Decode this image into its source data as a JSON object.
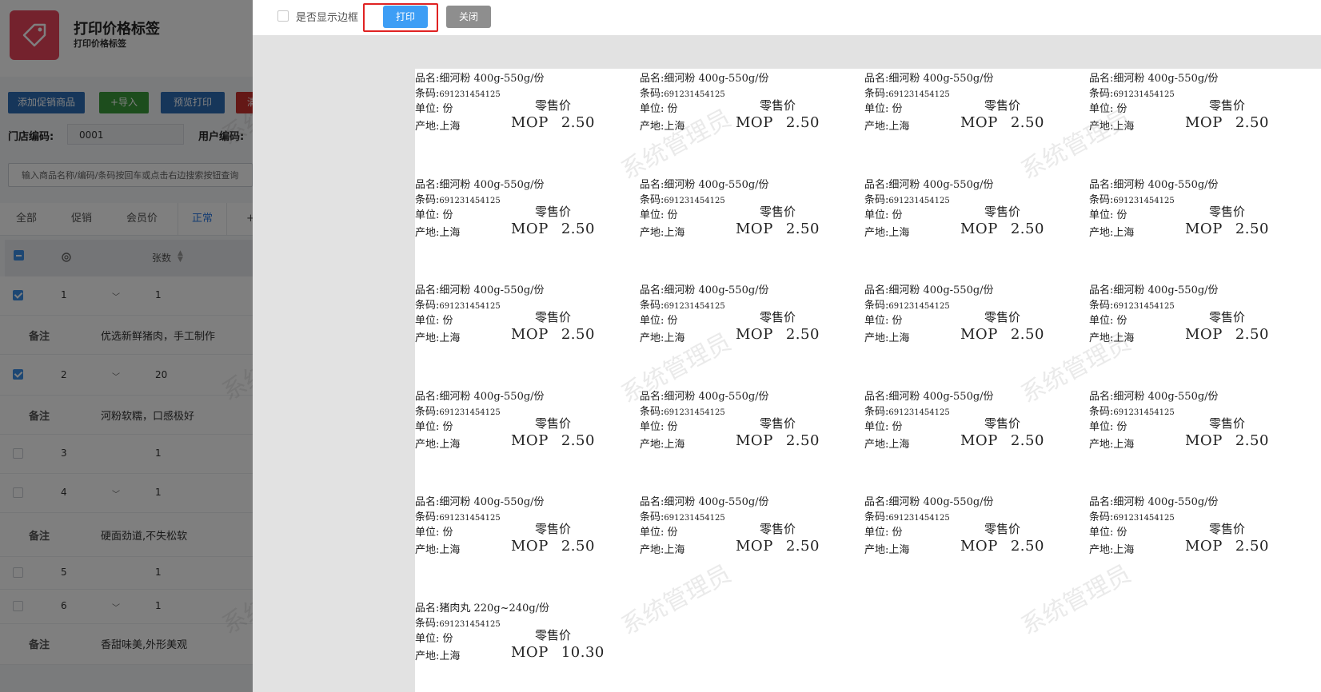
{
  "app": {
    "title": "打印价格标签",
    "subtitle": "打印价格标签",
    "toolbar": [
      {
        "label": "添加促销商品",
        "color": "#2d6db5"
      },
      {
        "label": "+导入",
        "color": "#3a9a3a"
      },
      {
        "label": "预览打印",
        "color": "#2d6db5"
      },
      {
        "label": "清",
        "color": "#c9302c"
      }
    ],
    "store_code_label": "门店编码:",
    "store_code_value": "0001",
    "user_code_label": "用户编码:",
    "search_placeholder": "输入商品名称/编码/条码按回车或点击右边搜索按钮查询",
    "tabs": [
      "全部",
      "促销",
      "会员价",
      "正常",
      "+"
    ],
    "active_tab": 3,
    "column_qty": "张数",
    "rows": [
      {
        "num": "1",
        "qty": "1",
        "checked": true,
        "note_label": "备注",
        "note": "优选新鲜猪肉，手工制作"
      },
      {
        "num": "2",
        "qty": "20",
        "checked": true,
        "note_label": "备注",
        "note": "河粉软糯，口感极好"
      },
      {
        "num": "3",
        "qty": "1",
        "checked": false,
        "note_label": "",
        "note": ""
      },
      {
        "num": "4",
        "qty": "1",
        "checked": false,
        "note_label": "备注",
        "note": "硬面劲道,不失松软"
      },
      {
        "num": "5",
        "qty": "1",
        "checked": false,
        "note_label": "",
        "note": ""
      },
      {
        "num": "6",
        "qty": "1",
        "checked": false,
        "note_label": "备注",
        "note": "香甜味美,外形美观"
      }
    ]
  },
  "dialog": {
    "show_border_label": "是否显示边框",
    "print_button": "打印",
    "close_button": "关闭",
    "watermark": "系统管理员",
    "labels_fields": {
      "name_prefix": "品名:",
      "code_prefix": "条码:",
      "unit_prefix": "单位:",
      "origin_prefix": "产地:",
      "retail_label": "零售价",
      "currency": "MOP"
    },
    "labels": [
      {
        "name": "细河粉 400g-550g/份",
        "code": "691231454125",
        "unit": "份",
        "origin": "上海",
        "price": "2.50",
        "count": 20
      },
      {
        "name": "猪肉丸 220g~240g/份",
        "code": "691231454125",
        "unit": "份",
        "origin": "上海",
        "price": "10.30",
        "count": 1
      }
    ]
  }
}
